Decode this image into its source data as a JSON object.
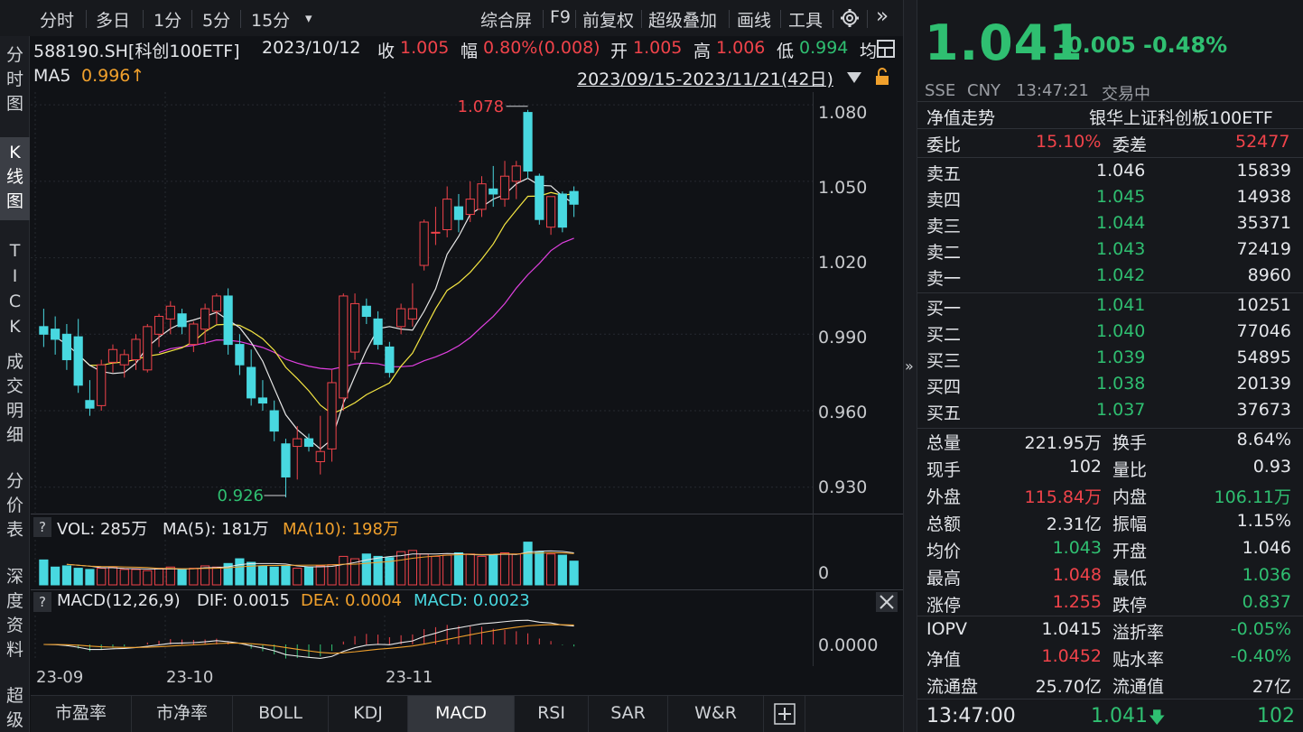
{
  "toolbar": {
    "tabs": [
      "分时",
      "多日",
      "1分",
      "5分",
      "15分"
    ],
    "dropdown": "▾",
    "right": [
      "综合屏",
      "F9",
      "前复权",
      "超级叠加",
      "画线",
      "工具"
    ],
    "more": "»"
  },
  "side_tabs": [
    "分时图",
    "K线图",
    "TICK",
    "成交明细",
    "分价表",
    "深度资料",
    "超级"
  ],
  "info": {
    "symbol": "588190.SH[科创100ETF]",
    "date": "2023/10/12",
    "close_label": "收",
    "close": "1.005",
    "range_label": "幅",
    "range": "0.80%(0.008)",
    "open_label": "开",
    "open": "1.005",
    "high_label": "高",
    "high": "1.006",
    "low_label": "低",
    "low": "0.994",
    "avg_label": "均",
    "ma5_label": "MA5",
    "ma5": "0.996↑",
    "period": "2023/09/15-2023/11/21(42日)"
  },
  "chart_data": {
    "type": "candlestick",
    "ylim": [
      0.92,
      1.085
    ],
    "y_ticks": [
      "1.080",
      "1.050",
      "1.020",
      "0.990",
      "0.960",
      "0.930"
    ],
    "x_ticks": [
      "23-09",
      "23-10",
      "23-11"
    ],
    "max_label": "1.078",
    "min_label": "0.926",
    "candles": [
      {
        "o": 0.993,
        "h": 1.0,
        "l": 0.985,
        "c": 0.99
      },
      {
        "o": 0.992,
        "h": 0.997,
        "l": 0.982,
        "c": 0.988
      },
      {
        "o": 0.99,
        "h": 0.994,
        "l": 0.976,
        "c": 0.98
      },
      {
        "o": 0.989,
        "h": 0.996,
        "l": 0.967,
        "c": 0.97
      },
      {
        "o": 0.964,
        "h": 0.972,
        "l": 0.958,
        "c": 0.961
      },
      {
        "o": 0.962,
        "h": 0.98,
        "l": 0.96,
        "c": 0.978
      },
      {
        "o": 0.979,
        "h": 0.986,
        "l": 0.975,
        "c": 0.984
      },
      {
        "o": 0.978,
        "h": 0.984,
        "l": 0.973,
        "c": 0.982
      },
      {
        "o": 0.98,
        "h": 0.99,
        "l": 0.976,
        "c": 0.988
      },
      {
        "o": 0.976,
        "h": 0.994,
        "l": 0.975,
        "c": 0.993
      },
      {
        "o": 0.99,
        "h": 0.998,
        "l": 0.985,
        "c": 0.997
      },
      {
        "o": 0.996,
        "h": 1.003,
        "l": 0.99,
        "c": 1.001
      },
      {
        "o": 0.998,
        "h": 1.0,
        "l": 0.99,
        "c": 0.993
      },
      {
        "o": 0.986,
        "h": 0.995,
        "l": 0.983,
        "c": 0.994
      },
      {
        "o": 0.992,
        "h": 1.002,
        "l": 0.986,
        "c": 1.0
      },
      {
        "o": 0.999,
        "h": 1.006,
        "l": 0.994,
        "c": 1.005
      },
      {
        "o": 1.005,
        "h": 1.008,
        "l": 0.982,
        "c": 0.986
      },
      {
        "o": 0.986,
        "h": 0.99,
        "l": 0.974,
        "c": 0.978
      },
      {
        "o": 0.977,
        "h": 0.984,
        "l": 0.962,
        "c": 0.965
      },
      {
        "o": 0.965,
        "h": 0.972,
        "l": 0.96,
        "c": 0.963
      },
      {
        "o": 0.96,
        "h": 0.964,
        "l": 0.948,
        "c": 0.952
      },
      {
        "o": 0.947,
        "h": 0.949,
        "l": 0.926,
        "c": 0.934
      },
      {
        "o": 0.946,
        "h": 0.954,
        "l": 0.933,
        "c": 0.949
      },
      {
        "o": 0.949,
        "h": 0.951,
        "l": 0.944,
        "c": 0.946
      },
      {
        "o": 0.94,
        "h": 0.958,
        "l": 0.935,
        "c": 0.944
      },
      {
        "o": 0.945,
        "h": 0.976,
        "l": 0.94,
        "c": 0.971
      },
      {
        "o": 0.965,
        "h": 1.006,
        "l": 0.96,
        "c": 1.005
      },
      {
        "o": 0.983,
        "h": 1.006,
        "l": 0.98,
        "c": 1.002
      },
      {
        "o": 1.001,
        "h": 1.004,
        "l": 0.994,
        "c": 0.997
      },
      {
        "o": 0.996,
        "h": 0.999,
        "l": 0.984,
        "c": 0.986
      },
      {
        "o": 0.985,
        "h": 0.987,
        "l": 0.973,
        "c": 0.975
      },
      {
        "o": 0.993,
        "h": 1.002,
        "l": 0.99,
        "c": 1.0
      },
      {
        "o": 0.996,
        "h": 1.01,
        "l": 0.993,
        "c": 1.0
      },
      {
        "o": 1.017,
        "h": 1.035,
        "l": 1.015,
        "c": 1.034
      },
      {
        "o": 1.03,
        "h": 1.04,
        "l": 1.025,
        "c": 1.03
      },
      {
        "o": 1.031,
        "h": 1.048,
        "l": 1.028,
        "c": 1.043
      },
      {
        "o": 1.04,
        "h": 1.045,
        "l": 1.03,
        "c": 1.035
      },
      {
        "o": 1.037,
        "h": 1.05,
        "l": 1.034,
        "c": 1.043
      },
      {
        "o": 1.039,
        "h": 1.052,
        "l": 1.036,
        "c": 1.049
      },
      {
        "o": 1.047,
        "h": 1.056,
        "l": 1.04,
        "c": 1.045
      },
      {
        "o": 1.043,
        "h": 1.058,
        "l": 1.04,
        "c": 1.052
      },
      {
        "o": 1.05,
        "h": 1.058,
        "l": 1.043,
        "c": 1.056
      },
      {
        "o": 1.077,
        "h": 1.078,
        "l": 1.051,
        "c": 1.054
      },
      {
        "o": 1.052,
        "h": 1.053,
        "l": 1.033,
        "c": 1.035
      },
      {
        "o": 1.032,
        "h": 1.044,
        "l": 1.029,
        "c": 1.044
      },
      {
        "o": 1.045,
        "h": 1.046,
        "l": 1.03,
        "c": 1.032
      },
      {
        "o": 1.046,
        "h": 1.048,
        "l": 1.036,
        "c": 1.041
      }
    ],
    "ma_colors": {
      "ma5": "#e8e8e8",
      "ma10": "#f5e642",
      "ma20": "#e040e0"
    },
    "volume": {
      "label": "VOL: 285万",
      "ma5_label": "MA(5): 181万",
      "ma10_label": "MA(10): 198万",
      "zero_label": "0",
      "values": [
        2.1,
        1.5,
        1.6,
        1.4,
        1.3,
        1.4,
        1.5,
        1.3,
        1.3,
        1.2,
        1.4,
        1.5,
        1.3,
        1.4,
        1.6,
        1.5,
        1.8,
        2.2,
        1.9,
        1.6,
        1.5,
        1.6,
        1.4,
        1.5,
        1.6,
        1.7,
        2.4,
        2.2,
        2.6,
        2.4,
        2.3,
        2.8,
        2.9,
        2.6,
        2.4,
        2.5,
        2.7,
        2.6,
        2.4,
        2.5,
        2.7,
        2.6,
        3.6,
        2.8,
        2.6,
        2.5,
        2.0
      ]
    },
    "macd": {
      "label": "MACD(12,26,9)",
      "dif_label": "DIF: 0.0015",
      "dea_label": "DEA: 0.0004",
      "macd_label": "MACD: 0.0023",
      "zero_label": "0.0000"
    }
  },
  "indicator_tabs": [
    "市盈率",
    "市净率",
    "BOLL",
    "KDJ",
    "MACD",
    "RSI",
    "SAR",
    "W&R"
  ],
  "indicator_active": "MACD",
  "quote": {
    "price": "1.041",
    "change": "-0.005",
    "change_pct": "-0.48%",
    "exchange": "SSE",
    "currency": "CNY",
    "time": "13:47:21",
    "status": "交易中",
    "nav_label": "净值走势",
    "name": "银华上证科创板100ETF",
    "weibi_label": "委比",
    "weibi": "15.10%",
    "weicha_label": "委差",
    "weicha": "52477",
    "asks": [
      {
        "label": "卖五",
        "price": "1.046",
        "vol": "15839"
      },
      {
        "label": "卖四",
        "price": "1.045",
        "vol": "14938"
      },
      {
        "label": "卖三",
        "price": "1.044",
        "vol": "35371"
      },
      {
        "label": "卖二",
        "price": "1.043",
        "vol": "72419"
      },
      {
        "label": "卖一",
        "price": "1.042",
        "vol": "8960"
      }
    ],
    "bids": [
      {
        "label": "买一",
        "price": "1.041",
        "vol": "10251"
      },
      {
        "label": "买二",
        "price": "1.040",
        "vol": "77046"
      },
      {
        "label": "买三",
        "price": "1.039",
        "vol": "54895"
      },
      {
        "label": "买四",
        "price": "1.038",
        "vol": "20139"
      },
      {
        "label": "买五",
        "price": "1.037",
        "vol": "37673"
      }
    ],
    "stats": [
      {
        "l1": "总量",
        "v1": "221.95万",
        "c1": "white",
        "l2": "换手",
        "v2": "8.64%",
        "c2": "white"
      },
      {
        "l1": "现手",
        "v1": "102",
        "c1": "white",
        "l2": "量比",
        "v2": "0.93",
        "c2": "white"
      },
      {
        "l1": "外盘",
        "v1": "115.84万",
        "c1": "up",
        "l2": "内盘",
        "v2": "106.11万",
        "c2": "down"
      },
      {
        "l1": "总额",
        "v1": "2.31亿",
        "c1": "white",
        "l2": "振幅",
        "v2": "1.15%",
        "c2": "white"
      },
      {
        "l1": "均价",
        "v1": "1.043",
        "c1": "down",
        "l2": "开盘",
        "v2": "1.046",
        "c2": "white"
      },
      {
        "l1": "最高",
        "v1": "1.048",
        "c1": "up",
        "l2": "最低",
        "v2": "1.036",
        "c2": "down"
      },
      {
        "l1": "涨停",
        "v1": "1.255",
        "c1": "up",
        "l2": "跌停",
        "v2": "0.837",
        "c2": "down"
      }
    ],
    "stats2": [
      {
        "l1": "IOPV",
        "v1": "1.0415",
        "c1": "white",
        "l2": "溢折率",
        "v2": "-0.05%",
        "c2": "down"
      },
      {
        "l1": "净值",
        "v1": "1.0452",
        "c1": "up",
        "l2": "贴水率",
        "v2": "-0.40%",
        "c2": "down"
      },
      {
        "l1": "流通盘",
        "v1": "25.70亿",
        "c1": "white",
        "l2": "流通值",
        "v2": "27亿",
        "c2": "white"
      }
    ],
    "tick_time": "13:47:00",
    "tick_price": "1.041",
    "tick_vol": "102"
  },
  "colors": {
    "up": "#f0434a",
    "down": "#2fbf71",
    "cyan": "#48d8e0"
  }
}
